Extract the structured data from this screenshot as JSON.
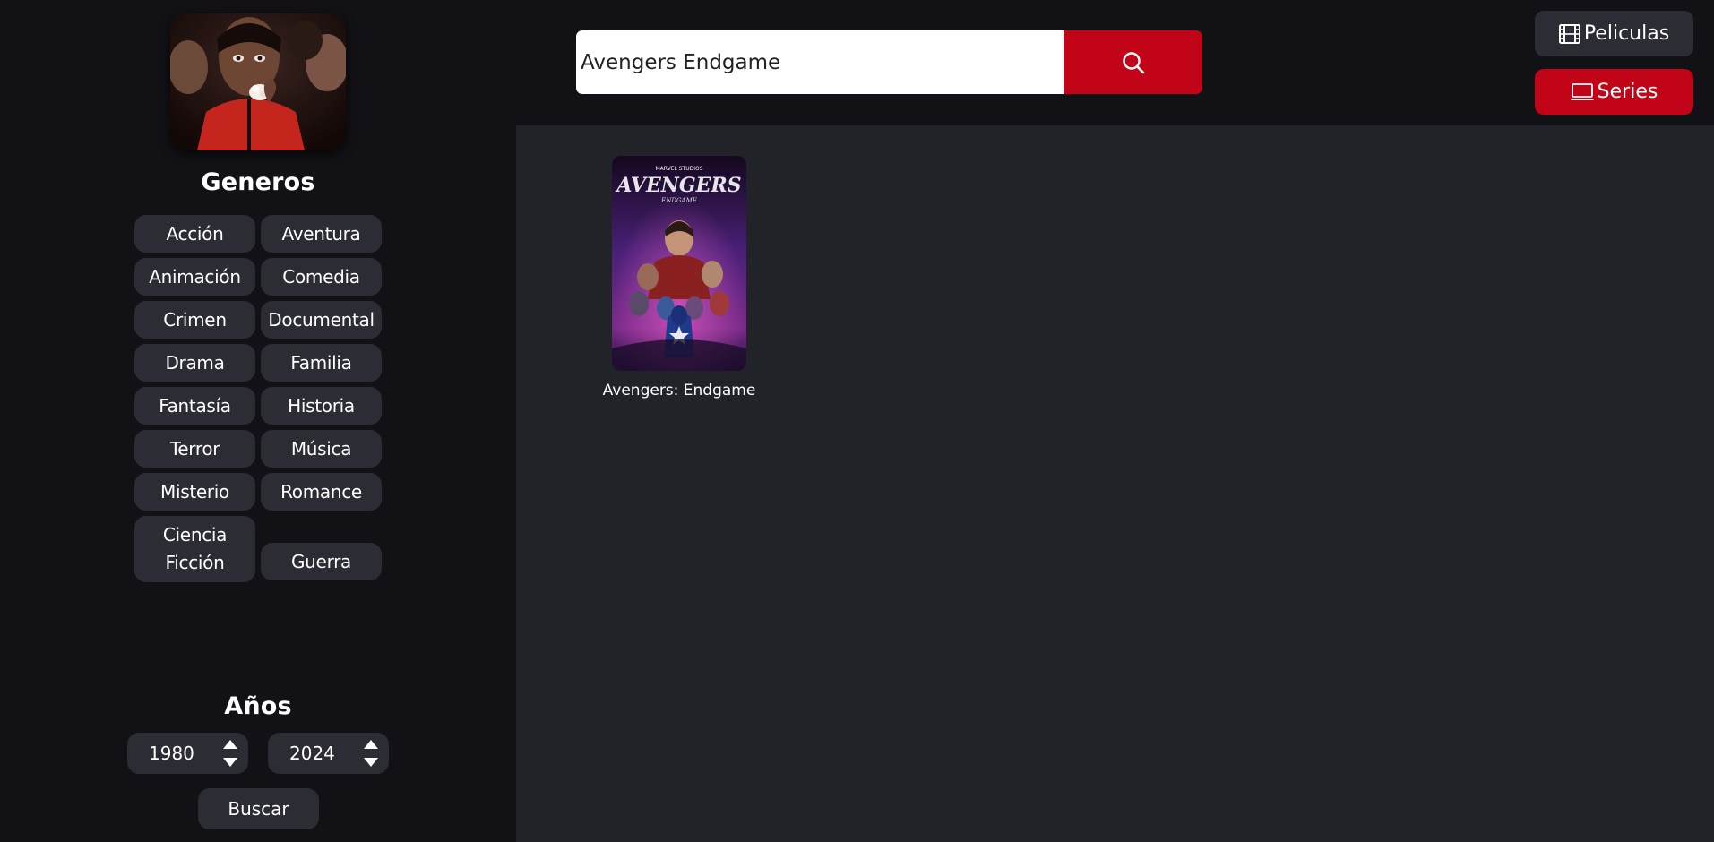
{
  "search": {
    "value": "Avengers Endgame"
  },
  "nav": {
    "movies_label": "Peliculas",
    "series_label": "Series"
  },
  "sidebar": {
    "genres_title": "Generos",
    "genres": [
      "Acción",
      "Aventura",
      "Animación",
      "Comedia",
      "Crimen",
      "Documental",
      "Drama",
      "Familia",
      "Fantasía",
      "Historia",
      "Terror",
      "Música",
      "Misterio",
      "Romance",
      "Ciencia Ficción",
      "Guerra"
    ],
    "years_title": "Años",
    "year_from": "1980",
    "year_to": "2024",
    "search_button": "Buscar"
  },
  "results": [
    {
      "title": "Avengers: Endgame",
      "poster_brand": "MARVEL STUDIOS",
      "poster_title": "AVENGERS",
      "poster_subtitle": "ENDGAME"
    }
  ],
  "colors": {
    "accent": "#c10418",
    "sidebar_bg": "#121116",
    "main_bg": "#212328",
    "button_bg": "#2b2c34"
  },
  "icons": {
    "search": "search-icon",
    "movies": "film-icon",
    "series": "tv-icon"
  }
}
